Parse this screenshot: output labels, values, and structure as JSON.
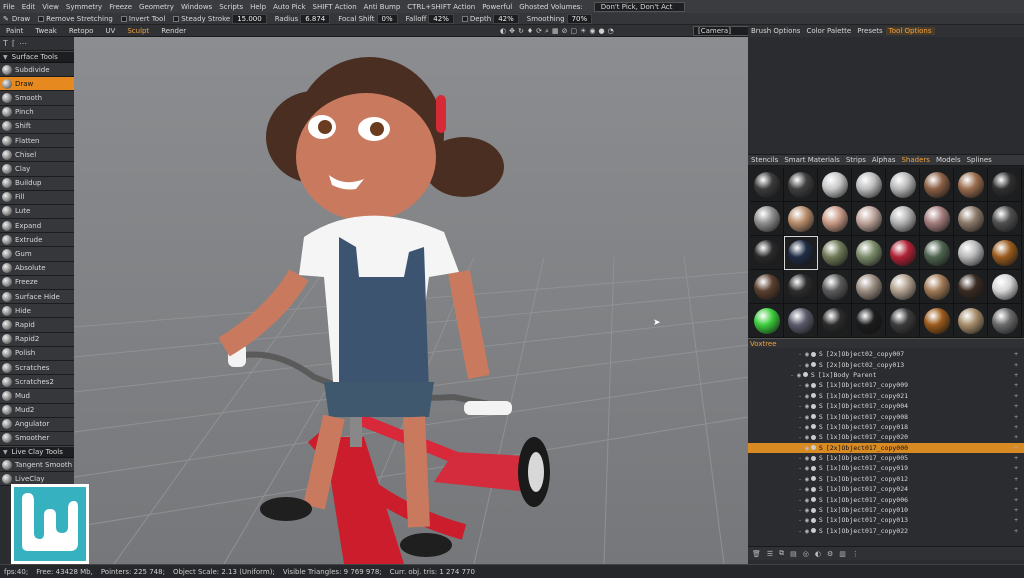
{
  "menubar": {
    "items": [
      "File",
      "Edit",
      "View",
      "Symmetry",
      "Freeze",
      "Geometry",
      "Windows",
      "Scripts",
      "Help",
      "Auto Pick",
      "SHIFT Action",
      "Anti Bump",
      "CTRL+SHIFT Action",
      "Powerful",
      "Ghosted Volumes:"
    ],
    "ghosted_value": "Don't Pick, Don't Act"
  },
  "toolbar": {
    "draw": "Draw",
    "remove_stretching": "Remove Stretching",
    "invert_tool": "Invert Tool",
    "steady_stroke_label": "Steady Stroke",
    "steady_stroke_value": "15.000",
    "radius_label": "Radius",
    "radius_value": "6.874",
    "focal_shift_label": "Focal Shift",
    "focal_shift_value": "0%",
    "falloff_label": "Falloff",
    "falloff_value": "42%",
    "depth_label": "Depth",
    "depth_value": "42%",
    "smoothing_label": "Smoothing",
    "smoothing_value": "70%"
  },
  "rooms": {
    "tabs": [
      "Paint",
      "Tweak",
      "Retopo",
      "UV",
      "Sculpt",
      "Render"
    ],
    "active": "Sculpt",
    "camera": "[Camera]"
  },
  "right_tabs": {
    "tabs": [
      "Brush Options",
      "Color Palette",
      "Presets",
      "Tool Options"
    ],
    "active": "Tool Options"
  },
  "tool_panel": {
    "surface_header": "Surface Tools",
    "surface_tools": [
      "Subdivide",
      "Draw",
      "Smooth",
      "Pinch",
      "Shift",
      "Flatten",
      "Chisel",
      "Clay",
      "Buildup",
      "Fill",
      "Lute",
      "Expand",
      "Extrude",
      "Gum",
      "Absolute",
      "Freeze",
      "Surface Hide",
      "Hide",
      "Rapid",
      "Rapid2",
      "Polish",
      "Scratches",
      "Scratches2",
      "Mud",
      "Mud2",
      "Angulator",
      "Smoother"
    ],
    "selected": "Draw",
    "liveclay_header": "Live Clay Tools",
    "liveclay_tools": [
      "Tangent Smooth",
      "LiveClay"
    ]
  },
  "shaders": {
    "tabs": [
      "Stencils",
      "Smart Materials",
      "Strips",
      "Alphas",
      "Shaders",
      "Models",
      "Splines"
    ],
    "active": "Shaders",
    "colors": [
      "#3b3b3b",
      "#3f3f3f",
      "#c7c7c7",
      "#bdbdbd",
      "#b8b8b8",
      "#8a5f45",
      "#9a6c4e",
      "#2f2f2f",
      "#8f8f8f",
      "#b88d6b",
      "#c89a86",
      "#bfa59c",
      "#b3b3b3",
      "#a57d7d",
      "#8c7a6a",
      "#505050",
      "#2a2a2a",
      "#1f2c44",
      "#6f7a58",
      "#7c8c6a",
      "#b02236",
      "#4f6450",
      "#b9b9b9",
      "#9a5b1e",
      "#5a3f2e",
      "#2c2c2c",
      "#5b5b5b",
      "#9a8c80",
      "#b0a08e",
      "#a17a56",
      "#3a2b22",
      "#d6d6d6",
      "#3ccc3c",
      "#5a5a6a",
      "#2b2b2b",
      "#1c1c1c",
      "#3c3c3c",
      "#9b5a1a",
      "#a58c6a",
      "#6a6a6a"
    ],
    "selected_index": 17
  },
  "voxtree": {
    "title": "Voxtree",
    "rows": [
      {
        "indent": 2,
        "label": "[2x]Object02_copy007"
      },
      {
        "indent": 2,
        "label": "[2x]Object02_copy013"
      },
      {
        "indent": 1,
        "label": "[1x]Body Parent"
      },
      {
        "indent": 2,
        "label": "[1x]Object017_copy009"
      },
      {
        "indent": 2,
        "label": "[1x]Object017_copy021"
      },
      {
        "indent": 2,
        "label": "[1x]Object017_copy004"
      },
      {
        "indent": 2,
        "label": "[1x]Object017_copy008"
      },
      {
        "indent": 2,
        "label": "[1x]Object017_copy018"
      },
      {
        "indent": 2,
        "label": "[1x]Object017_copy020"
      },
      {
        "indent": 2,
        "label": "[2x]Object017_copy000"
      },
      {
        "indent": 2,
        "label": "[1x]Object017_copy005"
      },
      {
        "indent": 2,
        "label": "[1x]Object017_copy019"
      },
      {
        "indent": 2,
        "label": "[1x]Object017_copy012"
      },
      {
        "indent": 2,
        "label": "[1x]Object017_copy024"
      },
      {
        "indent": 2,
        "label": "[1x]Object017_copy006"
      },
      {
        "indent": 2,
        "label": "[1x]Object017_copy010"
      },
      {
        "indent": 2,
        "label": "[1x]Object017_copy013"
      },
      {
        "indent": 2,
        "label": "[1x]Object017_copy022"
      }
    ],
    "selected_index": 9
  },
  "status": {
    "fps": "fps:40;",
    "free": "Free: 43428 Mb,",
    "pointers": "Pointers: 225 748;",
    "object_scale": "Object Scale: 2.13 (Uniform);",
    "visible_triangles": "Visible Triangles: 9 769 978;",
    "current_triangles": "Curr. obj. tris: 1 274 770"
  },
  "colors": {
    "accent": "#e68a1f",
    "logo": "#36b1bf"
  }
}
